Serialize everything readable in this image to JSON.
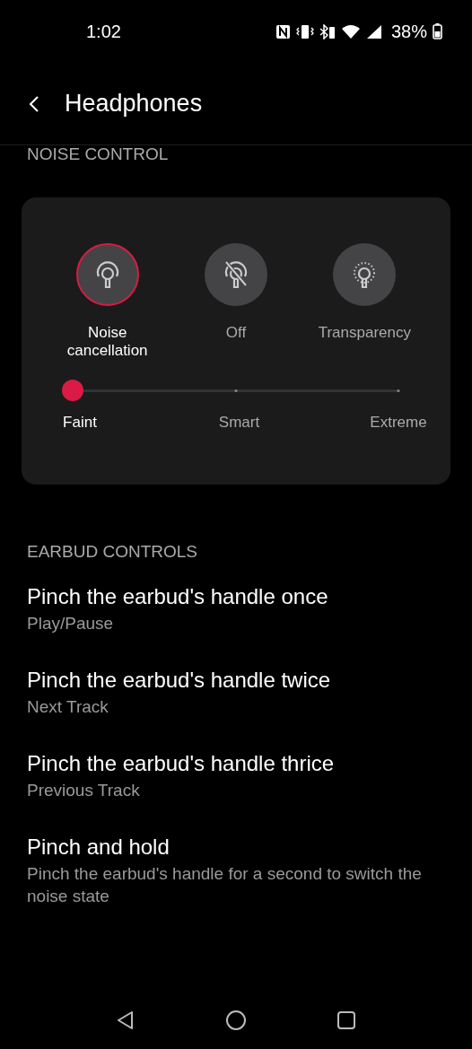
{
  "status_bar": {
    "time": "1:02",
    "battery": "38%"
  },
  "header": {
    "title": "Headphones"
  },
  "noise_control": {
    "heading": "NOISE CONTROL",
    "modes": [
      {
        "kind": "anc",
        "label": "Noise cancellation",
        "selected": true
      },
      {
        "kind": "off",
        "label": "Off",
        "selected": false
      },
      {
        "kind": "transparency",
        "label": "Transparency",
        "selected": false
      }
    ],
    "slider": {
      "level": 0,
      "stops": [
        {
          "label": "Faint",
          "selected": true
        },
        {
          "label": "Smart",
          "selected": false
        },
        {
          "label": "Extreme",
          "selected": false
        }
      ]
    }
  },
  "earbud_controls": {
    "heading": "EARBUD CONTROLS",
    "items": [
      {
        "title": "Pinch the earbud's handle once",
        "value": "Play/Pause"
      },
      {
        "title": "Pinch the earbud's handle twice",
        "value": "Next Track"
      },
      {
        "title": "Pinch the earbud's handle thrice",
        "value": "Previous Track"
      },
      {
        "title": "Pinch and hold",
        "value": "Pinch the earbud's handle for a second to switch the noise state"
      }
    ]
  }
}
